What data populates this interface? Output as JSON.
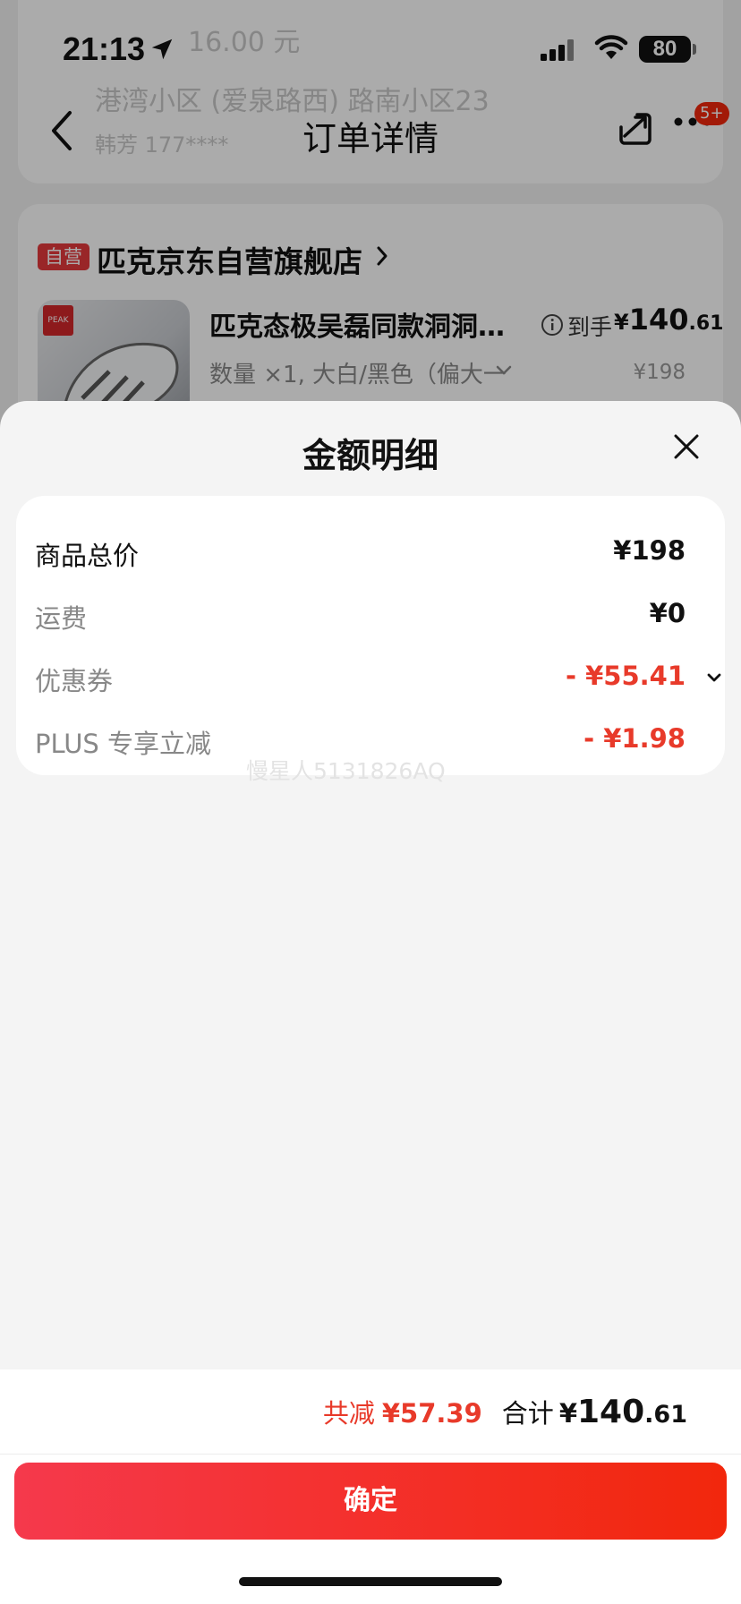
{
  "status_bar": {
    "time": "21:13",
    "battery": "80"
  },
  "background": {
    "ghost_line_1": "16.00 元",
    "ghost_line_2": "港湾小区 (爱泉路西) 路南小区23",
    "ghost_line_3": "韩芳 177****"
  },
  "nav": {
    "title": "订单详情",
    "badge": "5+"
  },
  "store": {
    "tag": "自营",
    "name": "匹克京东自营旗舰店",
    "product_logo": "PEAK",
    "product_title": "匹克态极吴磊同款洞洞…",
    "price_label": "到手",
    "price_currency": "¥",
    "price_int": "140",
    "price_dec": ".61",
    "spec": "数量 ×1, 大白/黑色（偏大一",
    "original_price": "¥198"
  },
  "sheet": {
    "title": "金额明细",
    "rows": [
      {
        "label": "商品总价",
        "value": "¥198"
      },
      {
        "label": "运费",
        "value": "¥0"
      },
      {
        "label": "优惠券",
        "value": "- ¥55.41"
      },
      {
        "label": "PLUS 专享立减",
        "value": "- ¥1.98"
      }
    ],
    "watermark": "慢星人5131826AQ"
  },
  "footer": {
    "saved_label": "共减",
    "saved_value": "¥57.39",
    "total_label": "合计",
    "total_currency": "¥",
    "total_int": "140",
    "total_dec": ".61",
    "confirm_label": "确定"
  },
  "colors": {
    "accent_red": "#e83a2a",
    "button_start": "#f5394c",
    "button_end": "#f2270c"
  }
}
